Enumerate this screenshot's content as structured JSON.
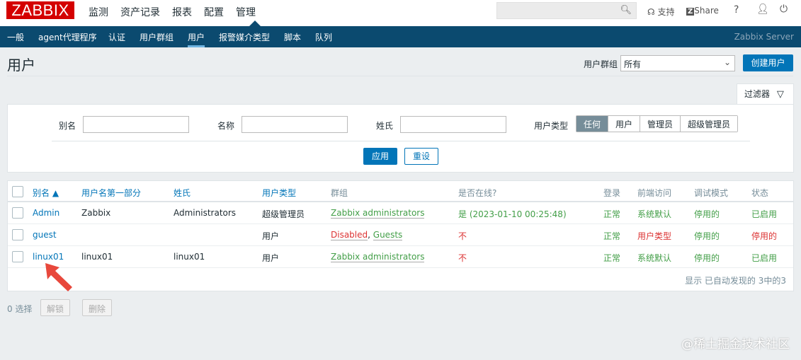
{
  "logo": "ZABBIX",
  "main_menu": [
    "监测",
    "资产记录",
    "报表",
    "配置",
    "管理"
  ],
  "top_right": {
    "support": "支持",
    "share": "Share",
    "help": "?"
  },
  "sub_menu": [
    "一般",
    "agent代理程序",
    "认证",
    "用户群组",
    "用户",
    "报警媒介类型",
    "脚本",
    "队列"
  ],
  "server_name": "Zabbix Server",
  "page_title": "用户",
  "user_group_label": "用户群组",
  "user_group_value": "所有",
  "create_user": "创建用户",
  "filter_tab": "过滤器",
  "filter": {
    "alias": "别名",
    "name": "名称",
    "surname": "姓氏",
    "user_type": "用户类型",
    "types": [
      "任何",
      "用户",
      "管理员",
      "超级管理员"
    ],
    "apply": "应用",
    "reset": "重设"
  },
  "table": {
    "headers": [
      "别名 ▲",
      "用户名第一部分",
      "姓氏",
      "用户类型",
      "群组",
      "是否在线?",
      "登录",
      "前端访问",
      "调试模式",
      "状态"
    ],
    "rows": [
      {
        "alias": "Admin",
        "name": "Zabbix",
        "surname": "Administrators",
        "type": "超级管理员",
        "group1": "Zabbix administrators",
        "group2": "",
        "online": "是 (2023-01-10 00:25:48)",
        "login": "正常",
        "frontend": "系统默认",
        "debug": "停用的",
        "status": "已启用"
      },
      {
        "alias": "guest",
        "name": "",
        "surname": "",
        "type": "用户",
        "group1": "Disabled",
        "group2": "Guests",
        "online": "不",
        "login": "正常",
        "frontend": "用户类型",
        "debug": "停用的",
        "status": "停用的"
      },
      {
        "alias": "linux01",
        "name": "linux01",
        "surname": "linux01",
        "type": "用户",
        "group1": "Zabbix administrators",
        "group2": "",
        "online": "不",
        "login": "正常",
        "frontend": "系统默认",
        "debug": "停用的",
        "status": "已启用"
      }
    ],
    "footer": "显示 已自动发现的 3中的3"
  },
  "selected": "0 选择",
  "unlock": "解锁",
  "delete": "删除",
  "watermark": "@稀土掘金技术社区"
}
